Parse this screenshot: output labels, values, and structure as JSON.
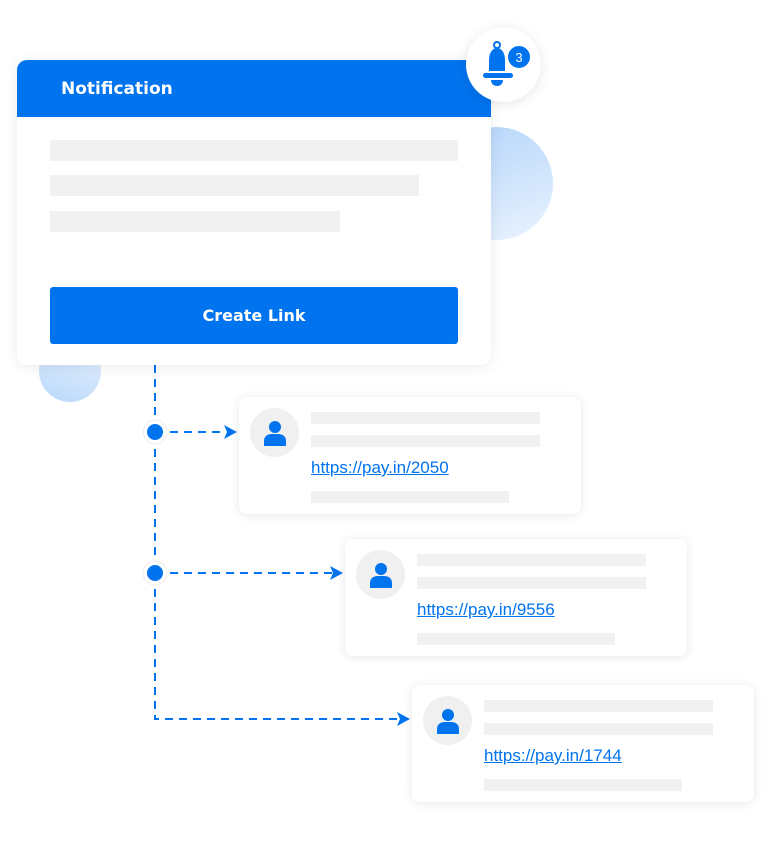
{
  "colors": {
    "accent": "#0073ef",
    "skeleton": "#f1f1f1",
    "avatar_bg": "#f0f0f0",
    "decor_circle": "#b3d4fb"
  },
  "notification_card": {
    "title": "Notification",
    "button_label": "Create Link",
    "skeleton_lines": 3
  },
  "bell": {
    "icon": "bell-icon",
    "badge_count": "3"
  },
  "connector": {
    "style": "dashed",
    "branches": 3,
    "arrow_icon": "arrow-right-icon"
  },
  "link_cards": [
    {
      "avatar_icon": "user-icon",
      "url": "https://pay.in/2050"
    },
    {
      "avatar_icon": "user-icon",
      "url": "https://pay.in/9556"
    },
    {
      "avatar_icon": "user-icon",
      "url": "https://pay.in/1744"
    }
  ]
}
